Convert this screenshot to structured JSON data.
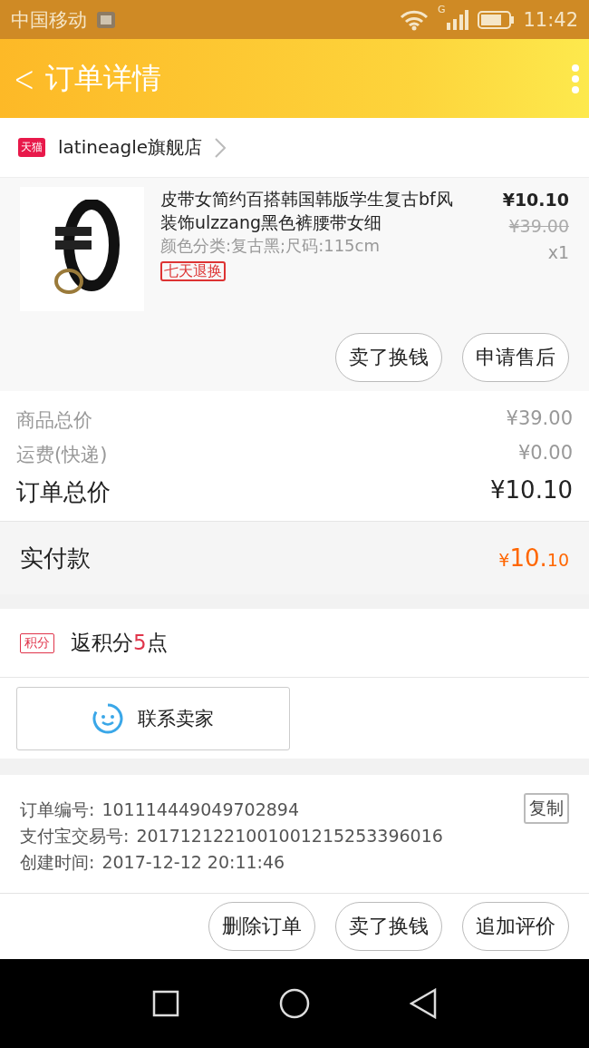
{
  "status_bar": {
    "carrier": "中国移动",
    "network": "G",
    "time": "11:42"
  },
  "app_bar": {
    "back": "<",
    "title": "订单详情"
  },
  "shop": {
    "name": "latineagle旗舰店",
    "badge": "天猫"
  },
  "item": {
    "title": "皮带女简约百搭韩国韩版学生复古bf风装饰ulzzang黑色裤腰带女细",
    "sku": "颜色分类:复古黑;尺码:115cm",
    "tag": "七天退换",
    "price": "¥10.10",
    "original_price": "¥39.00",
    "quantity": "x1",
    "actions": [
      "卖了换钱",
      "申请售后"
    ]
  },
  "summary": [
    {
      "label": "商品总价",
      "value": "¥39.00",
      "kind": "minor"
    },
    {
      "label": "运费(快递)",
      "value": "¥0.00",
      "kind": "minor"
    },
    {
      "label": "订单总价",
      "value": "¥10.10",
      "kind": "major"
    }
  ],
  "paid": {
    "label": "实付款",
    "currency": "¥",
    "main": "10.",
    "decimal": "10"
  },
  "points": {
    "badge": "积分",
    "prefix": "返积分",
    "value": "5",
    "suffix": "点"
  },
  "contact": {
    "label": "联系卖家"
  },
  "info": {
    "copy_button": "复制",
    "lines": [
      {
        "label": "订单编号:",
        "value": "101114449049702894"
      },
      {
        "label": "支付宝交易号:",
        "value": "2017121221001001215253396016"
      },
      {
        "label": "创建时间:",
        "value": "2017-12-12 20:11:46"
      }
    ]
  },
  "bottom_actions": [
    "删除订单",
    "卖了换钱",
    "追加评价"
  ]
}
